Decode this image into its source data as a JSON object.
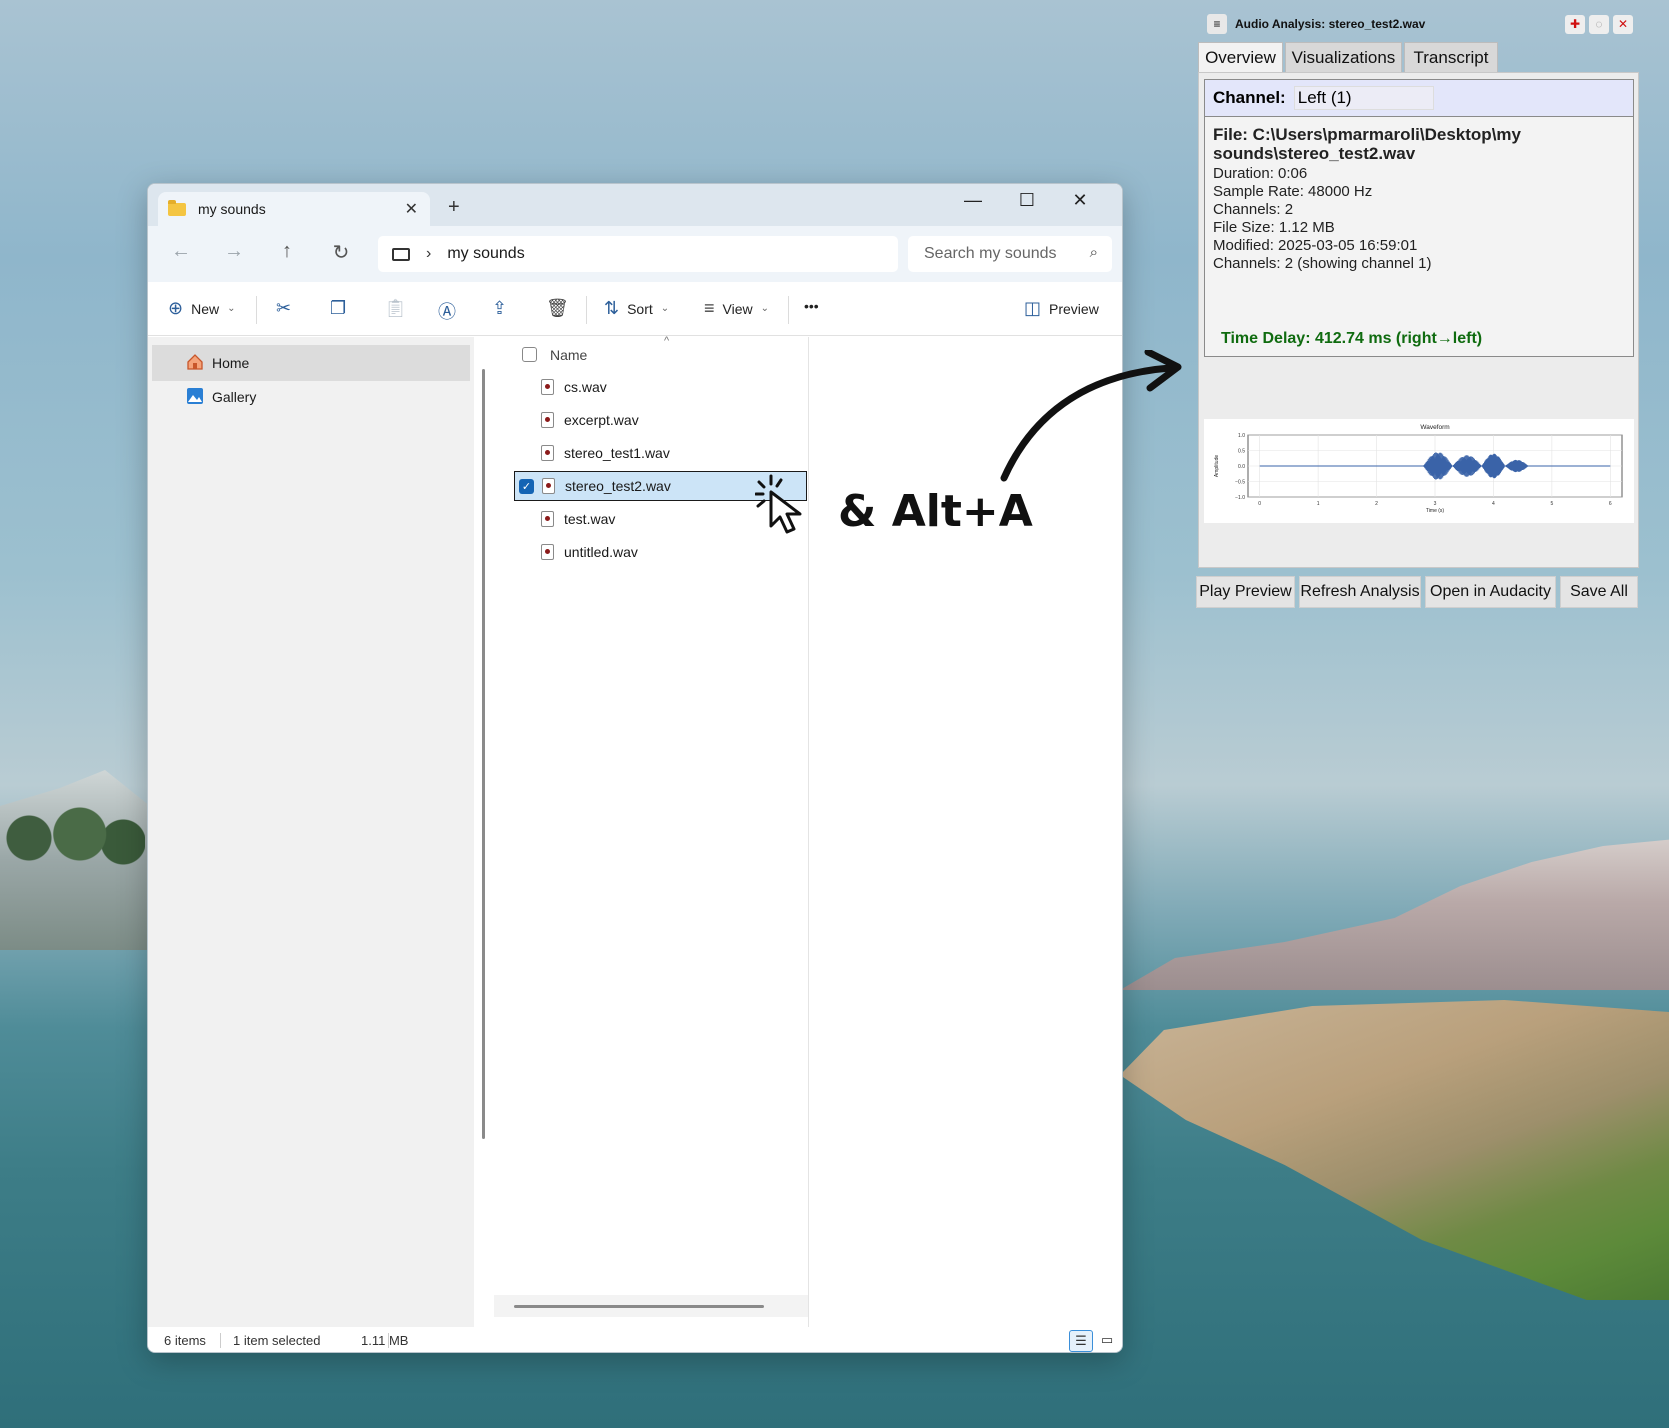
{
  "explorer": {
    "tab_title": "my sounds",
    "address_path": "my sounds",
    "search_placeholder": "Search my sounds",
    "toolbar": {
      "new_label": "New",
      "sort_label": "Sort",
      "view_label": "View",
      "more_label": "•••",
      "preview_label": "Preview"
    },
    "sidebar": {
      "items": [
        {
          "label": "Home",
          "icon": "home-icon"
        },
        {
          "label": "Gallery",
          "icon": "gallery-icon"
        }
      ]
    },
    "filelist": {
      "header_name": "Name",
      "files": [
        {
          "name": "cs.wav",
          "selected": false
        },
        {
          "name": "excerpt.wav",
          "selected": false
        },
        {
          "name": "stereo_test1.wav",
          "selected": false
        },
        {
          "name": "stereo_test2.wav",
          "selected": true
        },
        {
          "name": "test.wav",
          "selected": false
        },
        {
          "name": "untitled.wav",
          "selected": false
        }
      ]
    },
    "status": {
      "items_count": "6 items",
      "selection": "1 item selected",
      "size": "1.11 MB"
    }
  },
  "annotation": {
    "shortcut_text": "& Alt+A"
  },
  "audio_window": {
    "title": "Audio Analysis: stereo_test2.wav",
    "tabs": [
      "Overview",
      "Visualizations",
      "Transcript"
    ],
    "active_tab": "Overview",
    "channel_label": "Channel:",
    "channel_value": "Left (1)",
    "file_path": "File: C:\\Users\\pmarmaroli\\Desktop\\my sounds\\stereo_test2.wav",
    "info_lines": [
      "Duration: 0:06",
      "Sample Rate: 48000 Hz",
      "Channels: 2",
      "File Size: 1.12 MB",
      "Modified: 2025-03-05 16:59:01",
      "Channels: 2 (showing channel 1)"
    ],
    "time_delay": "Time Delay: 412.74 ms (right→left)",
    "buttons": [
      "Play Preview",
      "Refresh Analysis",
      "Open in Audacity",
      "Save All"
    ],
    "accent_green": "#0f6b0f"
  },
  "chart_data": {
    "type": "line",
    "title": "Waveform",
    "xlabel": "Time (s)",
    "ylabel": "Amplitude",
    "xlim": [
      -0.2,
      6.2
    ],
    "ylim": [
      -1.0,
      1.0
    ],
    "x_ticks": [
      "0",
      "1",
      "2",
      "3",
      "4",
      "5",
      "6"
    ],
    "y_ticks": [
      "1.0",
      "0.5",
      "0.0",
      "−0.5",
      "−1.0"
    ],
    "grid": true,
    "color": "#3a63a8",
    "bursts": [
      {
        "start": 2.8,
        "end": 3.3,
        "amplitude": 0.45
      },
      {
        "start": 3.3,
        "end": 3.8,
        "amplitude": 0.35
      },
      {
        "start": 3.8,
        "end": 4.2,
        "amplitude": 0.4
      },
      {
        "start": 4.2,
        "end": 4.6,
        "amplitude": 0.2
      }
    ]
  }
}
